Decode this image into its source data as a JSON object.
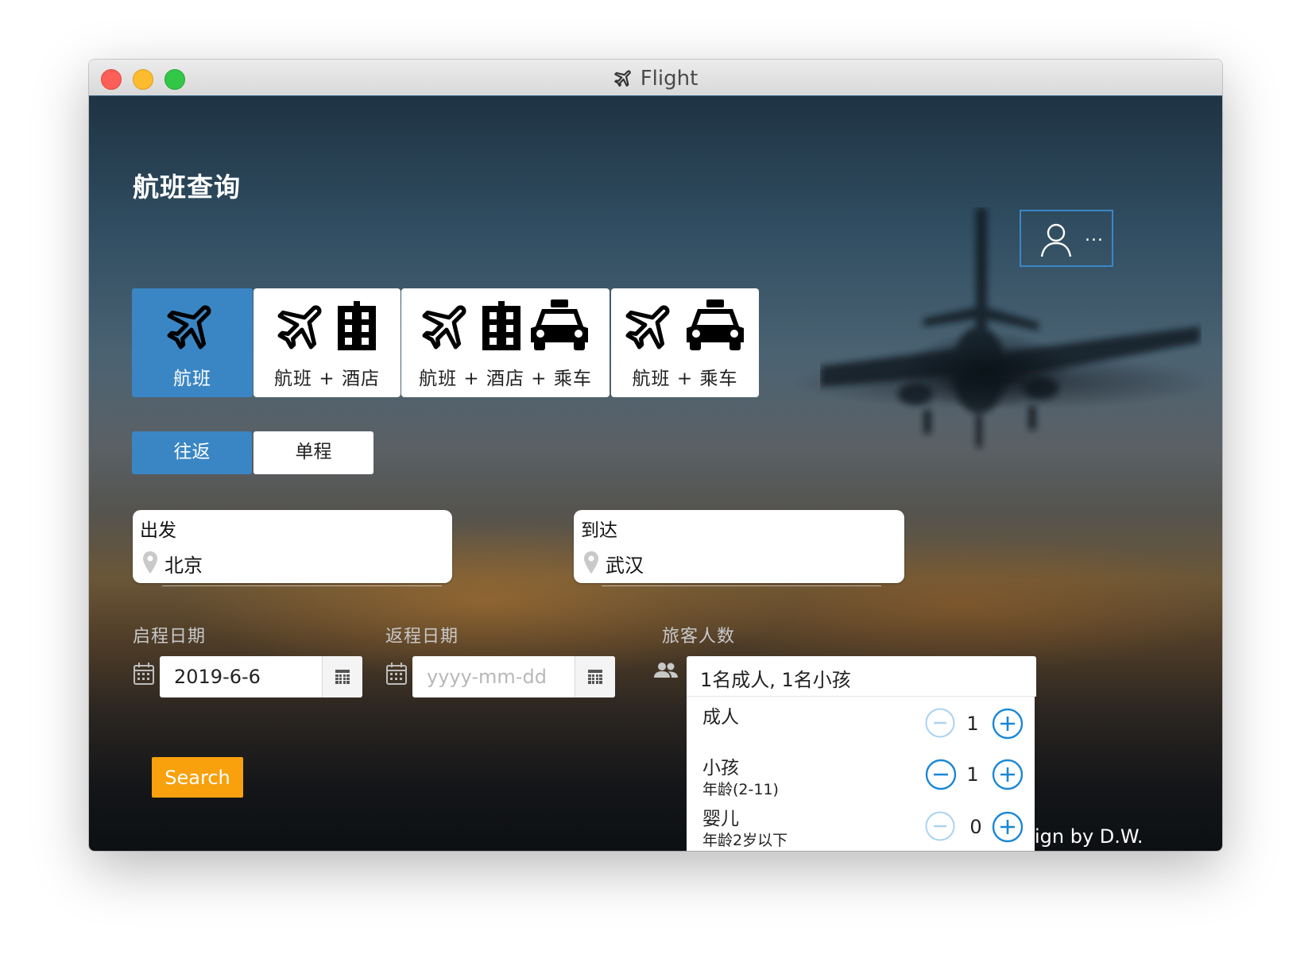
{
  "window": {
    "title": "Flight",
    "title_icon": "airplane-icon"
  },
  "header": {
    "page_title": "航班查询",
    "account_menu_dots": "...",
    "account_icon": "user-icon"
  },
  "trip_types": {
    "active_index": 0,
    "items": [
      {
        "label": "航班",
        "icons": [
          "airplane-icon"
        ]
      },
      {
        "label": "航班 + 酒店",
        "icons": [
          "airplane-icon",
          "building-icon"
        ]
      },
      {
        "label": "航班 + 酒店 + 乘车",
        "icons": [
          "airplane-icon",
          "building-icon",
          "taxi-icon"
        ]
      },
      {
        "label": "航班 + 乘车",
        "icons": [
          "airplane-icon",
          "taxi-icon"
        ]
      }
    ]
  },
  "direction": {
    "active_index": 0,
    "items": [
      {
        "label": "往返"
      },
      {
        "label": "单程"
      }
    ]
  },
  "from": {
    "label": "出发",
    "value": "北京"
  },
  "to": {
    "label": "到达",
    "value": "武汉"
  },
  "depart": {
    "label": "启程日期",
    "value": "2019-6-6",
    "placeholder": "yyyy-mm-dd"
  },
  "return": {
    "label": "返程日期",
    "value": "",
    "placeholder": "yyyy-mm-dd"
  },
  "passengers": {
    "label": "旅客人数",
    "summary": "1名成人, 1名小孩",
    "rows": [
      {
        "name": "成人",
        "sub": "",
        "count": "1",
        "minus_enabled": false
      },
      {
        "name": "小孩",
        "sub": "年龄(2-11)",
        "count": "1",
        "minus_enabled": true
      },
      {
        "name": "婴儿",
        "sub": "年龄2岁以下",
        "count": "0",
        "minus_enabled": false
      }
    ]
  },
  "search": {
    "label": "Search"
  },
  "footer": {
    "credit": "ign by D.W."
  },
  "colors": {
    "accent": "#3a86c4",
    "search": "#f8a10c",
    "stepper": "#1a87d6"
  }
}
